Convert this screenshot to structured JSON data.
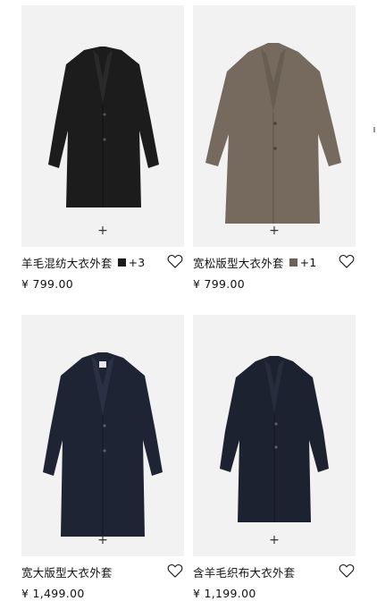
{
  "products": [
    {
      "name": "羊毛混纺大衣外套",
      "swatch_color": "#1a1a1a",
      "more_colors": "+3",
      "price": "¥ 799.00",
      "add_symbol": "+",
      "image": "black wool-blend overcoat",
      "coat_color": "#1c1c1c",
      "bg_color": "#f2f2f2"
    },
    {
      "name": "宽松版型大衣外套",
      "swatch_color": "#6e6258",
      "more_colors": "+1",
      "price": "¥ 799.00",
      "add_symbol": "+",
      "image": "taupe oversized overcoat",
      "coat_color": "#766a5f",
      "bg_color": "#f2f2f2"
    },
    {
      "name": "宽大版型大衣外套",
      "swatch_color": "",
      "more_colors": "",
      "price": "¥ 1,499.00",
      "add_symbol": "+",
      "image": "navy oversized overcoat",
      "coat_color": "#1e2433",
      "bg_color": "#f2f2f2"
    },
    {
      "name": "含羊毛织布大衣外套",
      "swatch_color": "",
      "more_colors": "",
      "price": "¥ 1,199.00",
      "add_symbol": "+",
      "image": "dark navy wool overcoat",
      "coat_color": "#1d2230",
      "bg_color": "#f2f2f2"
    }
  ],
  "icons": {
    "wishlist": "heart-outline-icon",
    "add": "plus-icon"
  }
}
